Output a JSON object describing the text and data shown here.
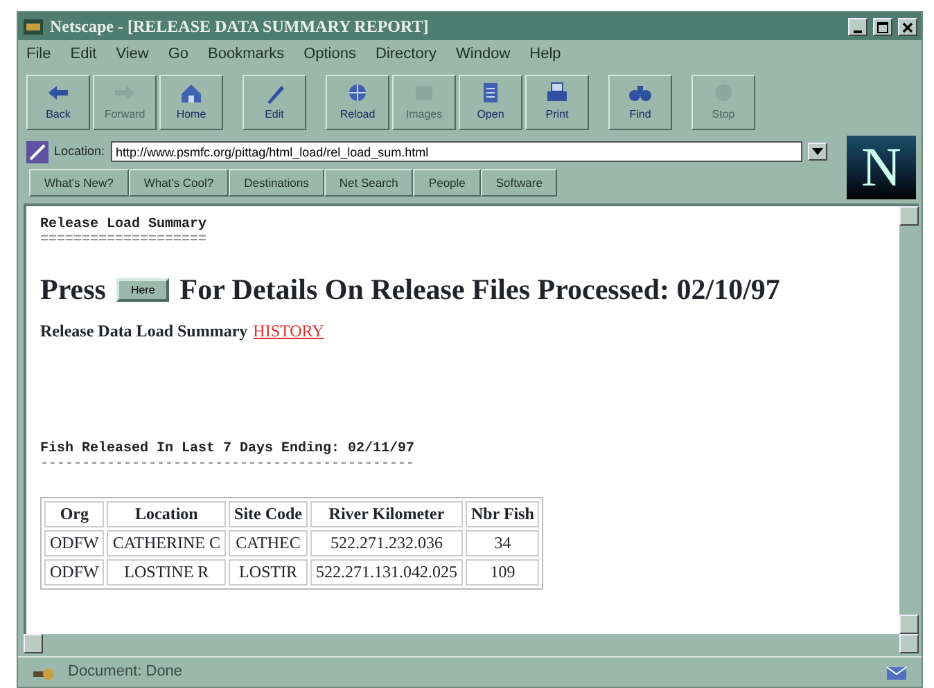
{
  "window": {
    "title": "Netscape - [RELEASE DATA SUMMARY REPORT]"
  },
  "menu": [
    "File",
    "Edit",
    "View",
    "Go",
    "Bookmarks",
    "Options",
    "Directory",
    "Window",
    "Help"
  ],
  "toolbar": [
    {
      "label": "Back",
      "disabled": false,
      "kind": "back"
    },
    {
      "label": "Forward",
      "disabled": true,
      "kind": "forward"
    },
    {
      "label": "Home",
      "disabled": false,
      "kind": "home"
    },
    {
      "label": "Edit",
      "disabled": false,
      "kind": "edit"
    },
    {
      "label": "Reload",
      "disabled": false,
      "kind": "reload"
    },
    {
      "label": "Images",
      "disabled": true,
      "kind": "images"
    },
    {
      "label": "Open",
      "disabled": false,
      "kind": "open"
    },
    {
      "label": "Print",
      "disabled": false,
      "kind": "print"
    },
    {
      "label": "Find",
      "disabled": false,
      "kind": "find"
    },
    {
      "label": "Stop",
      "disabled": true,
      "kind": "stop"
    }
  ],
  "location": {
    "label": "Location:",
    "value": "http://www.psmfc.org/pittag/html_load/rel_load_sum.html"
  },
  "directory_buttons": [
    "What's New?",
    "What's Cool?",
    "Destinations",
    "Net Search",
    "People",
    "Software"
  ],
  "logo": {
    "letter": "N"
  },
  "page": {
    "section_title": "Release Load Summary",
    "section_rule": "====================",
    "heading_before": "Press",
    "heading_button": "Here",
    "heading_after": "For Details On Release Files Processed: 02/10/97",
    "summary_text": "Release Data Load Summary",
    "summary_link": "HISTORY",
    "fish_title": "Fish Released In Last 7 Days Ending: 02/11/97",
    "fish_rule": "---------------------------------------------",
    "table": {
      "columns": [
        "Org",
        "Location",
        "Site Code",
        "River Kilometer",
        "Nbr Fish"
      ],
      "rows": [
        [
          "ODFW",
          "CATHERINE C",
          "CATHEC",
          "522.271.232.036",
          "34"
        ],
        [
          "ODFW",
          "LOSTINE R",
          "LOSTIR",
          "522.271.131.042.025",
          "109"
        ]
      ]
    }
  },
  "status_bar": {
    "text": "Document: Done"
  }
}
